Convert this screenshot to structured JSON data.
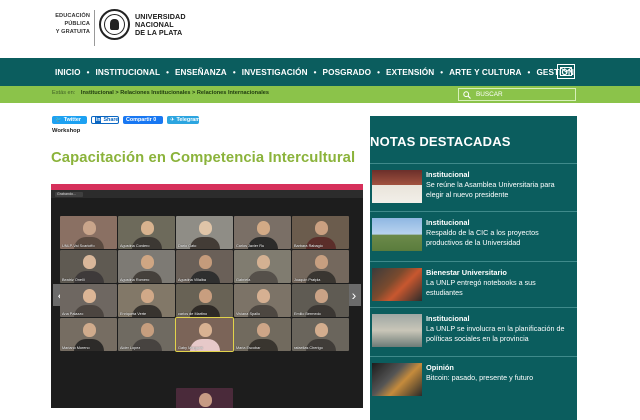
{
  "header": {
    "tagline": [
      "EDUCACIÓN",
      "PÚBLICA",
      "Y GRATUITA"
    ],
    "university": [
      "UNIVERSIDAD",
      "NACIONAL",
      "DE LA PLATA"
    ]
  },
  "nav": {
    "items": [
      "INICIO",
      "INSTITUCIONAL",
      "ENSEÑANZA",
      "INVESTIGACIÓN",
      "POSGRADO",
      "EXTENSIÓN",
      "ARTE Y CULTURA",
      "GESTIÓN"
    ]
  },
  "breadcrumb": {
    "label": "Estás en:",
    "items": [
      "Institucional >",
      "Relaciones Institucionales >",
      "Relaciones Internacionales"
    ]
  },
  "search": {
    "placeholder": "BUSCAR"
  },
  "share": {
    "twitter": "Twitter",
    "linkedin_badge": "in",
    "linkedin": "Share",
    "facebook": "Compartir 0",
    "telegram": "Telegram"
  },
  "article": {
    "category": "Workshop",
    "title": "Capacitación en Competencia Intercultural"
  },
  "video": {
    "recording": "Grabando...",
    "participants": [
      "UNLP-Vai Scarioffo",
      "Agustina Cordero",
      "Dario Gato",
      "Carlos Javier Ru",
      "Barbara Rabagio",
      "Beatriz Onelli",
      "Agustina Romero",
      "Agustina Villalba",
      "Gabriela",
      "Joaquin Pratpla",
      "Ana Palazzo",
      "Enriqueta Verte",
      "carlos de Martino",
      "Viviana Spallo",
      "Emilio Bermedo",
      "Mariano Moreno",
      "Alder Lopez",
      "Gaby Morganti",
      "Maria Escobar",
      "rafaellas Cherigo",
      "Lucia Gentile"
    ]
  },
  "sidebar": {
    "title": "NOTAS DESTACADAS",
    "items": [
      {
        "category": "Institucional",
        "headline": "Se reúne la Asamblea Universitaria para elegir al nuevo presidente"
      },
      {
        "category": "Institucional",
        "headline": "Respaldo de la CIC a los proyectos productivos de la Universidad"
      },
      {
        "category": "Bienestar Universitario",
        "headline": "La UNLP entregó notebooks a sus estudiantes"
      },
      {
        "category": "Institucional",
        "headline": "La UNLP se involucra en la planificación de políticas sociales en la provincia"
      },
      {
        "category": "Opinión",
        "headline": "Bitcoin: pasado, presente y futuro"
      }
    ]
  },
  "colors": {
    "nav_bg": "#0b5d5e",
    "breadcrumb_bg": "#8bc34a",
    "title_green": "#8bb33b",
    "video_topbar": "#d6305b"
  }
}
